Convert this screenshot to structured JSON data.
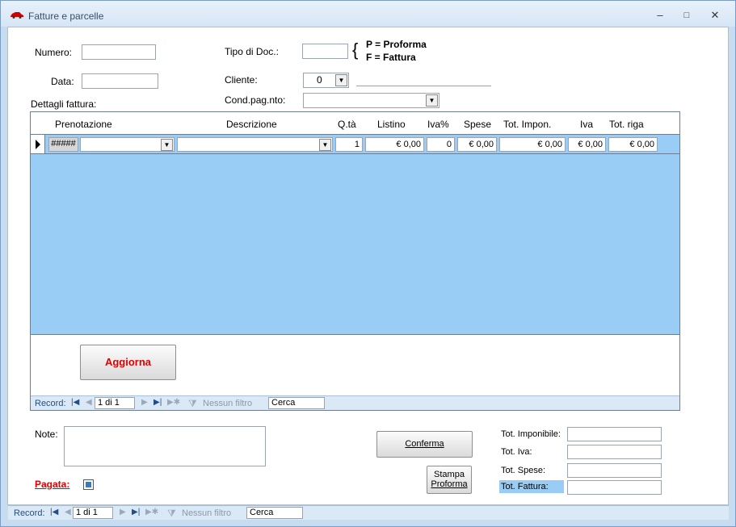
{
  "window": {
    "title": "Fatture e parcelle",
    "controls": {
      "minimize": "–",
      "maximize": "□",
      "close": "✕"
    }
  },
  "form": {
    "numero_label": "Numero:",
    "numero_value": "",
    "data_label": "Data:",
    "data_value": "",
    "tipo_doc_label": "Tipo di Doc.:",
    "tipo_doc_value": "",
    "tipo_doc_brace": "{",
    "tipo_doc_legend_p": "P = Proforma",
    "tipo_doc_legend_f": "F = Fattura",
    "cliente_label": "Cliente:",
    "cliente_value": "0",
    "cond_pag_label": "Cond.pag.nto:",
    "cond_pag_value": "",
    "dettagli_label": "Dettagli fattura:"
  },
  "subform": {
    "columns": [
      "Prenotazione",
      "Descrizione",
      "Q.tà",
      "Listino",
      "Iva%",
      "Spese",
      "Tot. Impon.",
      "Iva",
      "Tot. riga"
    ],
    "row": {
      "id": "#####",
      "prenotazione": "",
      "descrizione": "",
      "qta": "1",
      "listino": "€ 0,00",
      "iva_perc": "0",
      "spese": "€ 0,00",
      "tot_impon": "€ 0,00",
      "iva": "€ 0,00",
      "tot_riga": "€ 0,00"
    },
    "aggiorna_label": "Aggiorna",
    "nav": {
      "record_label": "Record:",
      "position": "1 di 1",
      "filter": "Nessun filtro",
      "search": "Cerca"
    }
  },
  "bottom": {
    "note_label": "Note:",
    "note_value": "",
    "pagata_label": "Pagata:",
    "conferma_label": "Conferma",
    "stampa_label_1": "Stampa",
    "stampa_label_2": "Proforma",
    "tot_imponibile_label": "Tot. Imponibile:",
    "tot_iva_label": "Tot. Iva:",
    "tot_spese_label": "Tot. Spese:",
    "tot_fattura_label": "Tot. Fattura:"
  },
  "main_nav": {
    "record_label": "Record:",
    "position": "1 di 1",
    "filter": "Nessun filtro",
    "search": "Cerca"
  },
  "colors": {
    "accent_red": "#e00000",
    "detail_bg": "#99cdf5",
    "nav_bg": "#dbe8f6",
    "tot_fattura_bg": "#99cdf5"
  },
  "icons": [
    "car-icon",
    "minimize-icon",
    "maximize-icon",
    "close-icon",
    "combo-arrow-icon",
    "record-selector-icon",
    "first-record-icon",
    "prev-record-icon",
    "next-record-icon",
    "last-record-icon",
    "new-record-icon",
    "filter-icon"
  ]
}
